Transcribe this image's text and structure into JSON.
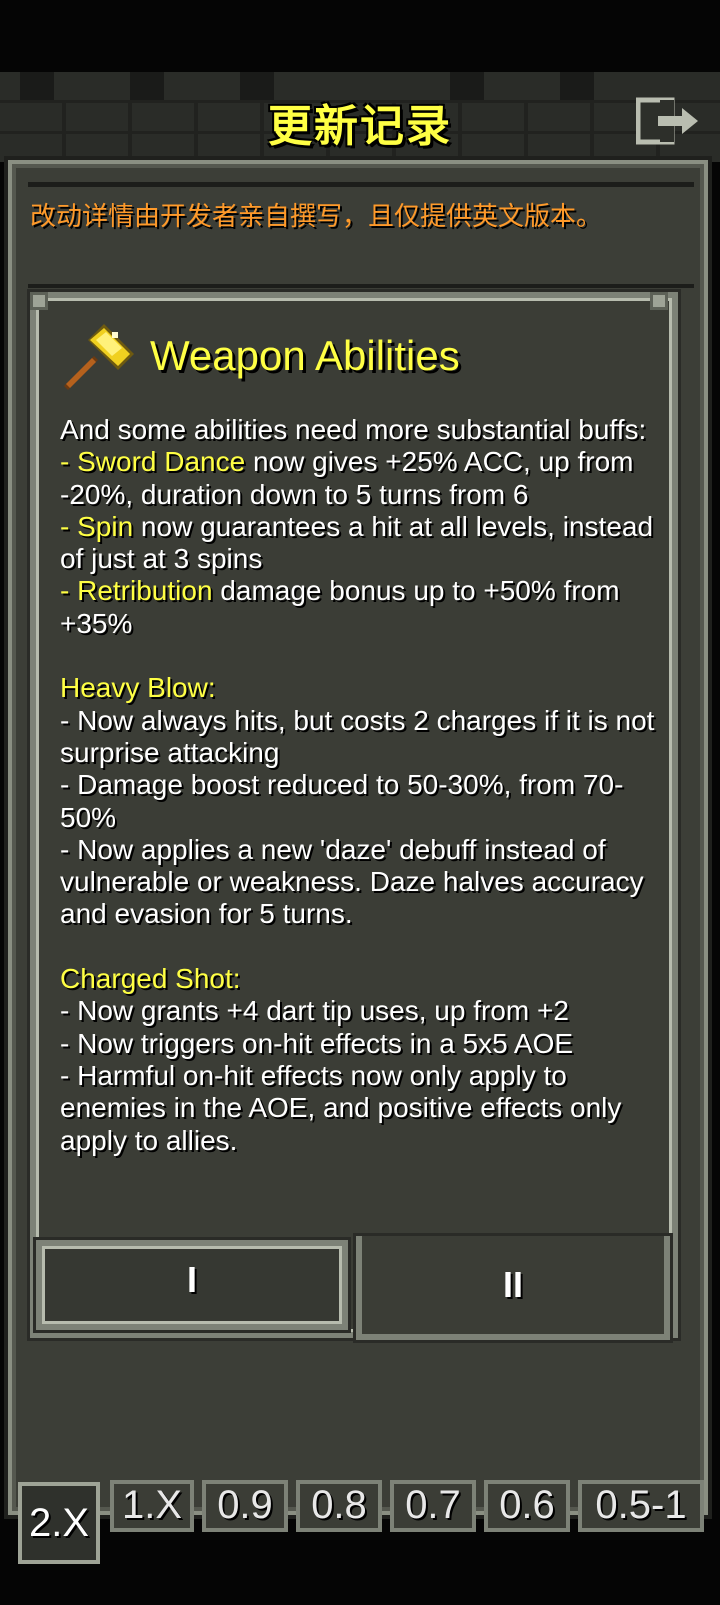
{
  "header": {
    "title": "更新记录",
    "exit_icon": "exit-icon"
  },
  "notice": {
    "text": "改动详情由开发者亲自撰写，且仅提供英文版本。",
    "color": "#ff9a2a"
  },
  "entry": {
    "icon": "golden-hammer-icon",
    "heading": "Weapon Abilities",
    "intro": "And some abilities need more substantial buffs:",
    "items_a": [
      {
        "prefix": "- ",
        "name": "Sword Dance",
        "text": " now gives +25% ACC, up from -20%, duration down to 5 turns from 6"
      },
      {
        "prefix": "- ",
        "name": "Spin",
        "text": " now guarantees a hit at all levels, instead of just at 3 spins"
      },
      {
        "prefix": "- ",
        "name": "Retribution",
        "text": " damage bonus up to +50% from +35%"
      }
    ],
    "heavy_blow": {
      "title": "Heavy Blow:",
      "lines": [
        "- Now always hits, but costs 2 charges if it is not surprise attacking",
        "- Damage boost reduced to 50-30%, from 70-50%",
        "- Now applies a new 'daze' debuff instead of vulnerable or weakness. Daze halves accuracy and evasion for 5 turns."
      ]
    },
    "charged_shot": {
      "title": "Charged Shot:",
      "lines": [
        "- Now grants +4 dart tip uses, up from +2",
        "- Now triggers on-hit effects in a 5x5 AOE",
        "- Harmful on-hit effects now only apply to enemies in the AOE, and positive effects only apply to allies."
      ]
    }
  },
  "tabs": [
    {
      "label": "I",
      "selected": false
    },
    {
      "label": "II",
      "selected": true
    }
  ],
  "versions": [
    {
      "label": "2.X",
      "selected": true
    },
    {
      "label": "1.X",
      "selected": false
    },
    {
      "label": "0.9",
      "selected": false
    },
    {
      "label": "0.8",
      "selected": false
    },
    {
      "label": "0.7",
      "selected": false
    },
    {
      "label": "0.6",
      "selected": false
    },
    {
      "label": "0.5-1",
      "selected": false
    }
  ],
  "colors": {
    "highlight": "#ffff44",
    "text": "#ffffff",
    "panel": "#3b3d36",
    "border": "#7d8277"
  }
}
